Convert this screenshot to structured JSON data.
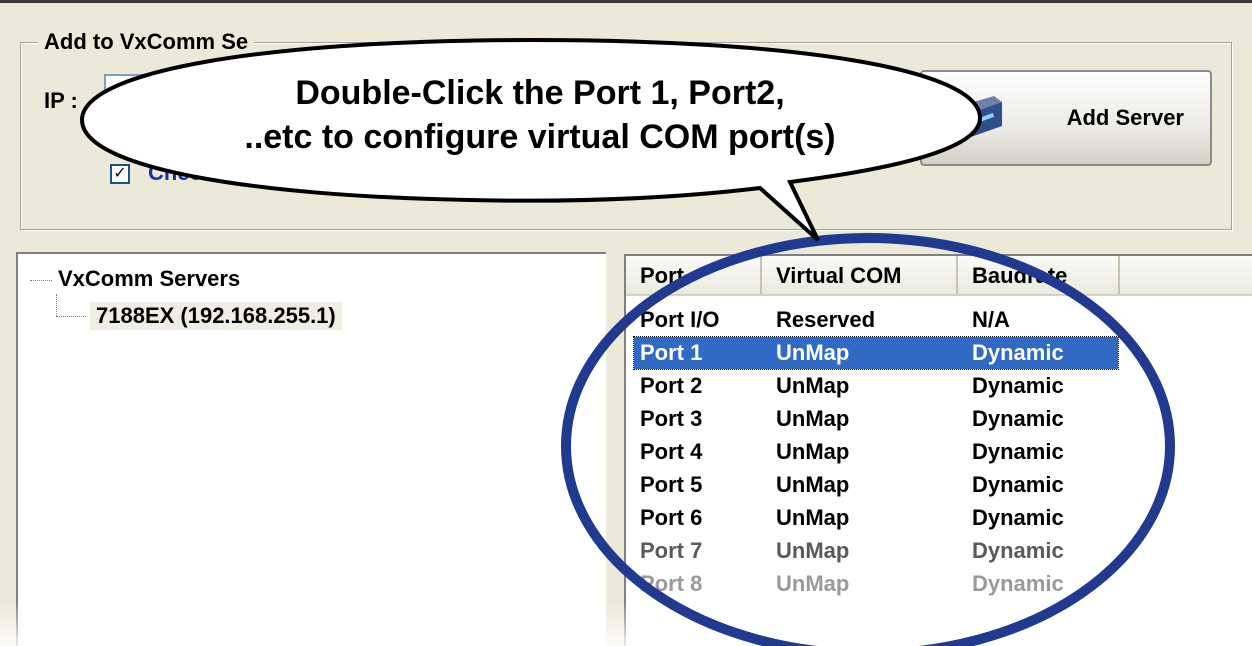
{
  "group": {
    "title": "Add to VxComm Se",
    "ip_label": "IP :",
    "check_label": "Chec",
    "checked": true,
    "add_server_label": "Add Server"
  },
  "tree": {
    "root": "VxComm Servers",
    "child": "7188EX (192.168.255.1)"
  },
  "list": {
    "columns": [
      "Port",
      "Virtual COM",
      "Baudrate"
    ],
    "rows": [
      {
        "port": "Port I/O",
        "com": "Reserved",
        "baud": "N/A"
      },
      {
        "port": "Port 1",
        "com": "UnMap",
        "baud": "Dynamic"
      },
      {
        "port": "Port 2",
        "com": "UnMap",
        "baud": "Dynamic"
      },
      {
        "port": "Port 3",
        "com": "UnMap",
        "baud": "Dynamic"
      },
      {
        "port": "Port 4",
        "com": "UnMap",
        "baud": "Dynamic"
      },
      {
        "port": "Port 5",
        "com": "UnMap",
        "baud": "Dynamic"
      },
      {
        "port": "Port 6",
        "com": "UnMap",
        "baud": "Dynamic"
      },
      {
        "port": "Port 7",
        "com": "UnMap",
        "baud": "Dynamic"
      },
      {
        "port": "Port 8",
        "com": "UnMap",
        "baud": "Dynamic"
      }
    ],
    "selected_row": "Port 1"
  },
  "callout": {
    "line1": "Double-Click the Port 1, Port2,",
    "line2": "..etc to configure virtual COM port(s)"
  },
  "colors": {
    "selection": "#316ac5",
    "highlight_ellipse": "#1f3a8f",
    "check_label": "#1a2fb0"
  }
}
